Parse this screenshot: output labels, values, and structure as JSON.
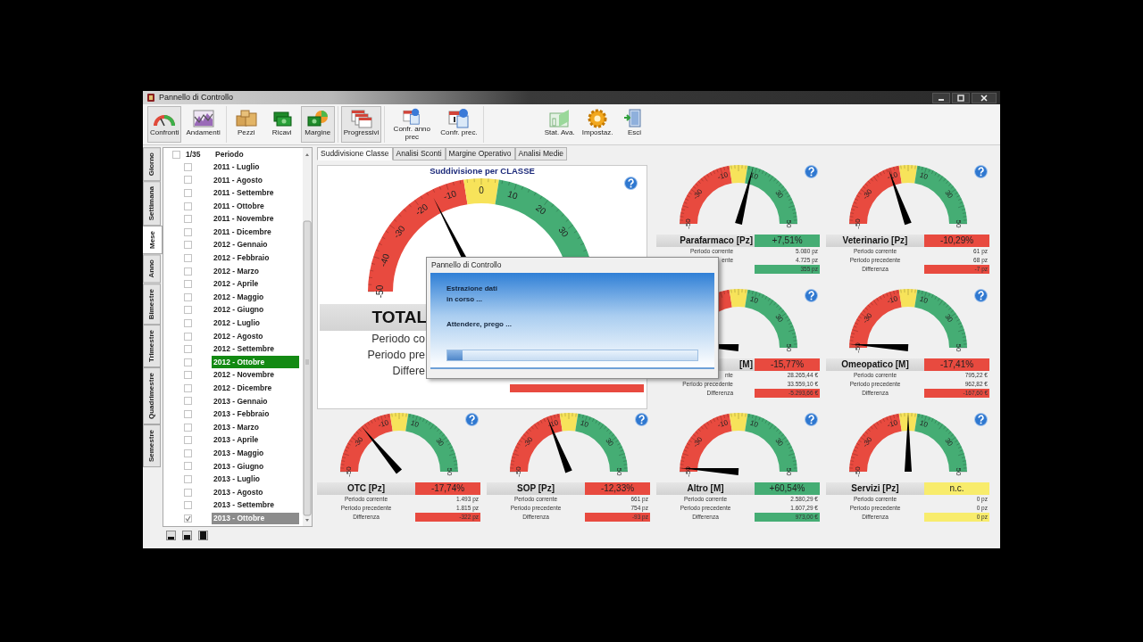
{
  "window": {
    "title": "Pannello di Controllo"
  },
  "toolbar": [
    {
      "buttons": [
        {
          "label": "Confronti",
          "kind": "gauge",
          "selected": true
        },
        {
          "label": "Andamenti",
          "kind": "trend",
          "selected": false
        }
      ]
    },
    {
      "buttons": [
        {
          "label": "Pezzi",
          "kind": "boxes",
          "selected": false
        },
        {
          "label": "Ricavi",
          "kind": "money",
          "selected": false
        },
        {
          "label": "Margine",
          "kind": "margin",
          "selected": true
        }
      ]
    },
    {
      "buttons": [
        {
          "label": "Progressivi",
          "kind": "calendars",
          "selected": true
        }
      ]
    },
    {
      "buttons": [
        {
          "label": "Confr. anno prec",
          "kind": "calendar-badge",
          "selected": false
        },
        {
          "label": "Confr. prec.",
          "kind": "calendar-one",
          "selected": false
        }
      ]
    },
    {
      "buttons": [
        {
          "label": "Stat. Ava.",
          "kind": "stats",
          "selected": false
        },
        {
          "label": "Impostaz.",
          "kind": "gear",
          "selected": false
        },
        {
          "label": "Esci",
          "kind": "exit",
          "selected": false
        }
      ]
    }
  ],
  "period_tabs": [
    {
      "label": "Giorno",
      "selected": false
    },
    {
      "label": "Settimana",
      "selected": false
    },
    {
      "label": "Mese",
      "selected": true
    },
    {
      "label": "Anno",
      "selected": false
    },
    {
      "label": "Bimestre",
      "selected": false
    },
    {
      "label": "Trimestre",
      "selected": false
    },
    {
      "label": "Quadrimestre",
      "selected": false
    },
    {
      "label": "Semestre",
      "selected": false
    }
  ],
  "periods": {
    "counter": "1/35",
    "header_checked": false,
    "column": "Periodo",
    "rows": [
      {
        "label": "2011 - Luglio",
        "checked": false,
        "selected": false,
        "focused": false
      },
      {
        "label": "2011 - Agosto",
        "checked": false,
        "selected": false,
        "focused": false
      },
      {
        "label": "2011 - Settembre",
        "checked": false,
        "selected": false,
        "focused": false
      },
      {
        "label": "2011 - Ottobre",
        "checked": false,
        "selected": false,
        "focused": false
      },
      {
        "label": "2011 - Novembre",
        "checked": false,
        "selected": false,
        "focused": false
      },
      {
        "label": "2011 - Dicembre",
        "checked": false,
        "selected": false,
        "focused": false
      },
      {
        "label": "2012 - Gennaio",
        "checked": false,
        "selected": false,
        "focused": false
      },
      {
        "label": "2012 - Febbraio",
        "checked": false,
        "selected": false,
        "focused": false
      },
      {
        "label": "2012 - Marzo",
        "checked": false,
        "selected": false,
        "focused": false
      },
      {
        "label": "2012 - Aprile",
        "checked": false,
        "selected": false,
        "focused": false
      },
      {
        "label": "2012 - Maggio",
        "checked": false,
        "selected": false,
        "focused": false
      },
      {
        "label": "2012 - Giugno",
        "checked": false,
        "selected": false,
        "focused": false
      },
      {
        "label": "2012 - Luglio",
        "checked": false,
        "selected": false,
        "focused": false
      },
      {
        "label": "2012 - Agosto",
        "checked": false,
        "selected": false,
        "focused": false
      },
      {
        "label": "2012 - Settembre",
        "checked": false,
        "selected": false,
        "focused": false
      },
      {
        "label": "2012 - Ottobre",
        "checked": false,
        "selected": true,
        "focused": false
      },
      {
        "label": "2012 - Novembre",
        "checked": false,
        "selected": false,
        "focused": false
      },
      {
        "label": "2012 - Dicembre",
        "checked": false,
        "selected": false,
        "focused": false
      },
      {
        "label": "2013 - Gennaio",
        "checked": false,
        "selected": false,
        "focused": false
      },
      {
        "label": "2013 - Febbraio",
        "checked": false,
        "selected": false,
        "focused": false
      },
      {
        "label": "2013 - Marzo",
        "checked": false,
        "selected": false,
        "focused": false
      },
      {
        "label": "2013 - Aprile",
        "checked": false,
        "selected": false,
        "focused": false
      },
      {
        "label": "2013 - Maggio",
        "checked": false,
        "selected": false,
        "focused": false
      },
      {
        "label": "2013 - Giugno",
        "checked": false,
        "selected": false,
        "focused": false
      },
      {
        "label": "2013 - Luglio",
        "checked": false,
        "selected": false,
        "focused": false
      },
      {
        "label": "2013 - Agosto",
        "checked": false,
        "selected": false,
        "focused": false
      },
      {
        "label": "2013 - Settembre",
        "checked": false,
        "selected": false,
        "focused": false
      },
      {
        "label": "2013 - Ottobre",
        "checked": true,
        "selected": false,
        "focused": true
      }
    ]
  },
  "tabs": [
    {
      "label": "Suddivisione Classe",
      "selected": true
    },
    {
      "label": "Analisi Sconti",
      "selected": false
    },
    {
      "label": "Margine Operativo",
      "selected": false
    },
    {
      "label": "Analisi Medie",
      "selected": false
    }
  ],
  "overview": {
    "title": "Suddivisione per CLASSE",
    "scale": [
      "-50",
      "-40",
      "-30",
      "-20",
      "-10",
      "0",
      "10",
      "20",
      "30"
    ],
    "total": "TOTAL",
    "rows": [
      "Periodo co",
      "Periodo pre",
      "Differe"
    ],
    "color": "#e84a3f"
  },
  "gauges": [
    {
      "name": "Parafarmaco [Pz]",
      "percent": "+7,51%",
      "color": "#45ad74",
      "scale": [
        "-50",
        "-30",
        "-10",
        "10",
        "30",
        "50"
      ],
      "rows": [
        {
          "label": "Periodo corrente",
          "value": "5.080 pz"
        },
        {
          "label": "ente",
          "value": "4.725 pz"
        },
        {
          "value": "355 pz"
        }
      ]
    },
    {
      "name": "Veterinario [Pz]",
      "percent": "-10,29%",
      "color": "#e84a3f",
      "scale": [
        "-50",
        "-30",
        "-10",
        "10",
        "30",
        "50"
      ],
      "rows": [
        {
          "label": "Periodo corrente",
          "value": "61 pz"
        },
        {
          "label": "Periodo precedente",
          "value": "68 pz"
        },
        {
          "label": "Differenza",
          "value": "-7 pz"
        }
      ]
    },
    {
      "name": "[M]",
      "percent": "-15,77%",
      "color": "#e84a3f",
      "scale": [
        "10",
        "30",
        "50"
      ],
      "rows": [
        {
          "label": "nte",
          "value": "28.265,44 €"
        },
        {
          "label": "Periodo precedente",
          "value": "33.559,10 €"
        },
        {
          "label": "Differenza",
          "value": "-5.293,66 €"
        }
      ]
    },
    {
      "name": "Omeopatico [M]",
      "percent": "-17,41%",
      "color": "#e84a3f",
      "scale": [
        "-50",
        "-30",
        "-10",
        "10",
        "30",
        "50"
      ],
      "rows": [
        {
          "label": "Periodo corrente",
          "value": "795,22 €"
        },
        {
          "label": "Periodo precedente",
          "value": "962,82 €"
        },
        {
          "label": "Differenza",
          "value": "-167,60 €"
        }
      ]
    },
    {
      "name": "OTC [Pz]",
      "percent": "-17,74%",
      "color": "#e84a3f",
      "scale": [
        "-50",
        "-30",
        "-10",
        "10",
        "30",
        "50"
      ],
      "rows": [
        {
          "label": "Periodo corrente",
          "value": "1.493 pz"
        },
        {
          "label": "Periodo precedente",
          "value": "1.815 pz"
        },
        {
          "label": "Differenza",
          "value": "-322 pz"
        }
      ]
    },
    {
      "name": "SOP [Pz]",
      "percent": "-12,33%",
      "color": "#e84a3f",
      "scale": [
        "-50",
        "-30",
        "-10",
        "10",
        "30",
        "50"
      ],
      "rows": [
        {
          "label": "Periodo corrente",
          "value": "661 pz"
        },
        {
          "label": "Periodo precedente",
          "value": "754 pz"
        },
        {
          "label": "Differenza",
          "value": "-93 pz"
        }
      ]
    },
    {
      "name": "Altro [M]",
      "percent": "+60,54%",
      "color": "#45ad74",
      "scale": [
        "-50",
        "-30",
        "-10",
        "10",
        "30",
        "50"
      ],
      "rows": [
        {
          "label": "Periodo corrente",
          "value": "2.580,29 €"
        },
        {
          "label": "Periodo precedente",
          "value": "1.607,29 €"
        },
        {
          "label": "Differenza",
          "value": "973,00 €"
        }
      ]
    },
    {
      "name": "Servizi [Pz]",
      "percent": "n.c.",
      "color": "#f8ec6c",
      "scale": [
        "-50",
        "-30",
        "-10",
        "10",
        "30",
        "50"
      ],
      "rows": [
        {
          "label": "Periodo corrente",
          "value": "0 pz"
        },
        {
          "label": "Periodo precedente",
          "value": "0 pz"
        },
        {
          "label": "Differenza",
          "value": "0 pz"
        }
      ]
    }
  ],
  "dialog": {
    "title": "Pannello di Controllo",
    "lines": [
      "Estrazione dati",
      "in corso ...",
      "Attendere, prego ..."
    ],
    "level": 0.06
  }
}
